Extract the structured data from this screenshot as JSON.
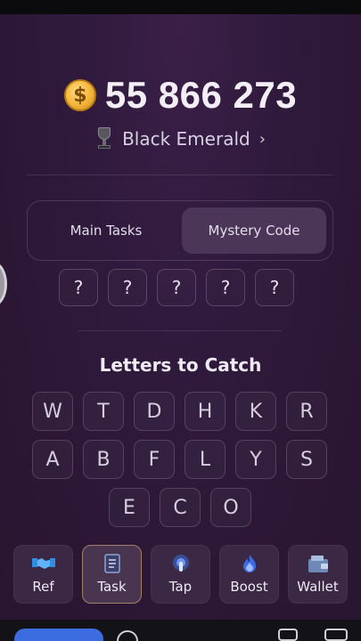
{
  "balance": {
    "value": "55 866 273",
    "coin_symbol": "$"
  },
  "rank": {
    "label": "Black Emerald",
    "chevron": "›"
  },
  "tabs": [
    {
      "label": "Main Tasks",
      "active": false
    },
    {
      "label": "Mystery Code",
      "active": true
    }
  ],
  "mystery_slots": [
    "?",
    "?",
    "?",
    "?",
    "?"
  ],
  "letters": {
    "title": "Letters to Catch",
    "row1": [
      "W",
      "T",
      "D",
      "H",
      "K",
      "R"
    ],
    "row2": [
      "A",
      "B",
      "F",
      "L",
      "Y",
      "S"
    ],
    "row3": [
      "E",
      "C",
      "O"
    ]
  },
  "nav": [
    {
      "label": "Ref",
      "icon": "handshake-icon"
    },
    {
      "label": "Task",
      "icon": "checklist-icon",
      "active": true
    },
    {
      "label": "Tap",
      "icon": "tap-icon"
    },
    {
      "label": "Boost",
      "icon": "fire-icon"
    },
    {
      "label": "Wallet",
      "icon": "wallet-icon"
    }
  ],
  "colors": {
    "accent": "#4b3658",
    "background": "#2f1a3c",
    "coin": "#f4b53a",
    "active_border": "#a27f67"
  }
}
